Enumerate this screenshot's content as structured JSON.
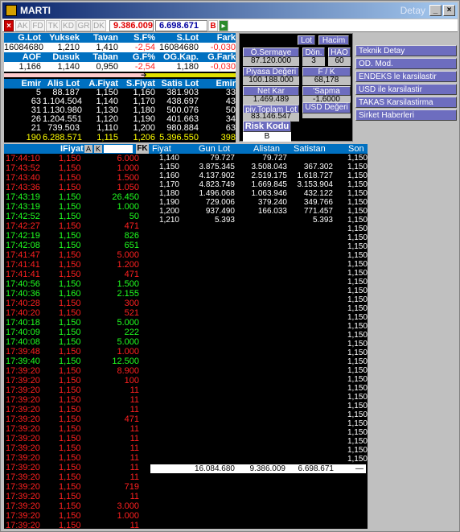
{
  "window": {
    "title": "MARTI",
    "detay": "Detay"
  },
  "toolbar": {
    "tabs": [
      "AK",
      "FD",
      "TK",
      "KD",
      "GR",
      "DK"
    ],
    "value1": "9.386.009",
    "value2": "6.698.671",
    "b_label": "B"
  },
  "summary": {
    "headers1": [
      "G.Lot",
      "Yuksek",
      "Tavan",
      "S.F%",
      "S.Lot",
      "Fark"
    ],
    "values1": [
      "16084680",
      "1,210",
      "1,410",
      "-2,54",
      "16084680",
      "-0,030"
    ],
    "headers2": [
      "AOF",
      "Dusuk",
      "Taban",
      "G.F%",
      "OG.Kap.",
      "G.Fark"
    ],
    "values2": [
      "1,166",
      "1,140",
      "0,950",
      "-2,54",
      "1,180",
      "-0,030"
    ],
    "book_headers": [
      "Emir",
      "Alis Lot",
      "A.Fiyat",
      "S.Fiyat",
      "Satis Lot",
      "Emir"
    ],
    "book_rows": [
      [
        "5",
        "88.187",
        "1,150",
        "1,160",
        "381.903",
        "33"
      ],
      [
        "63",
        "1.104.504",
        "1,140",
        "1,170",
        "438.697",
        "43"
      ],
      [
        "31",
        "1.130.980",
        "1,130",
        "1,180",
        "500.076",
        "50"
      ],
      [
        "26",
        "1.204.551",
        "1,120",
        "1,190",
        "401.663",
        "34"
      ],
      [
        "21",
        "739.503",
        "1,110",
        "1,200",
        "980.884",
        "63"
      ]
    ],
    "book_total": [
      "190",
      "6.288.571",
      "1,115",
      "1,206",
      "5.396.550",
      "398"
    ]
  },
  "panel": {
    "lot": "Lot",
    "hacim": "Hacim",
    "o_sermaye": "Ö.Sermaye",
    "o_sermaye_val": "87.120.000",
    "don": "Dön.",
    "don_val": "3",
    "hao": "HAO",
    "hao_val": "60",
    "piyasa": "Piyasa Değeri",
    "piyasa_val": "100.188.000",
    "fk": "F / K",
    "fk_val": "68,178",
    "netkar": "Net Kar",
    "netkar_val": "1.469.489",
    "sapma": "'Sapma",
    "sapma_val": "-1,6000",
    "toplam": "piy.Toplam Lot",
    "toplam_val": "83.146.547",
    "usd": "USD Değeri",
    "risk": "Risk Kodu",
    "risk_val": "B"
  },
  "links": [
    "Teknik Detay",
    "OD. Mod.",
    "ENDEKS le karsilastir",
    "USD ile karsilastir",
    "TAKAS Karsilastirma",
    "Sirket Haberleri"
  ],
  "trades": {
    "header": {
      "fiyat": "IFiyat",
      "a": "A",
      "k": "K",
      "fk": "FK"
    },
    "rows": [
      [
        "17:44:10",
        "1,150",
        "6.000",
        "r"
      ],
      [
        "17:43:52",
        "1,150",
        "1.000",
        "r"
      ],
      [
        "17:43:40",
        "1,150",
        "1.500",
        "r"
      ],
      [
        "17:43:36",
        "1,150",
        "1.050",
        "r"
      ],
      [
        "17:43:19",
        "1,150",
        "26.450",
        "g"
      ],
      [
        "17:43:19",
        "1,150",
        "1.000",
        "g"
      ],
      [
        "17:42:52",
        "1,150",
        "50",
        "g"
      ],
      [
        "17:42:27",
        "1,150",
        "471",
        "r"
      ],
      [
        "17:42:19",
        "1,150",
        "826",
        "g"
      ],
      [
        "17:42:08",
        "1,150",
        "651",
        "g"
      ],
      [
        "17:41:47",
        "1,150",
        "5.000",
        "r"
      ],
      [
        "17:41:41",
        "1,150",
        "1.200",
        "r"
      ],
      [
        "17:41:41",
        "1,150",
        "471",
        "r"
      ],
      [
        "17:40:56",
        "1,150",
        "1.500",
        "g"
      ],
      [
        "17:40:36",
        "1,160",
        "2.155",
        "g"
      ],
      [
        "17:40:28",
        "1,150",
        "300",
        "r"
      ],
      [
        "17:40:20",
        "1,150",
        "521",
        "r"
      ],
      [
        "17:40:18",
        "1,150",
        "5.000",
        "g"
      ],
      [
        "17:40:09",
        "1,150",
        "222",
        "g"
      ],
      [
        "17:40:08",
        "1,150",
        "5.000",
        "g"
      ],
      [
        "17:39:48",
        "1,150",
        "1.000",
        "r"
      ],
      [
        "17:39:40",
        "1,150",
        "12.500",
        "g"
      ],
      [
        "17:39:20",
        "1,150",
        "8.900",
        "r"
      ],
      [
        "17:39:20",
        "1,150",
        "100",
        "r"
      ],
      [
        "17:39:20",
        "1,150",
        "11",
        "r"
      ],
      [
        "17:39:20",
        "1,150",
        "11",
        "r"
      ],
      [
        "17:39:20",
        "1,150",
        "11",
        "r"
      ],
      [
        "17:39:20",
        "1,150",
        "471",
        "r"
      ],
      [
        "17:39:20",
        "1,150",
        "11",
        "r"
      ],
      [
        "17:39:20",
        "1,150",
        "11",
        "r"
      ],
      [
        "17:39:20",
        "1,150",
        "11",
        "r"
      ],
      [
        "17:39:20",
        "1,150",
        "11",
        "r"
      ],
      [
        "17:39:20",
        "1,150",
        "11",
        "r"
      ],
      [
        "17:39:20",
        "1,150",
        "11",
        "r"
      ],
      [
        "17:39:20",
        "1,150",
        "719",
        "r"
      ],
      [
        "17:39:20",
        "1,150",
        "11",
        "r"
      ],
      [
        "17:39:20",
        "1,150",
        "3.000",
        "r"
      ],
      [
        "17:39:20",
        "1,150",
        "1.000",
        "r"
      ],
      [
        "17:39:20",
        "1,150",
        "11",
        "r"
      ]
    ]
  },
  "depth": {
    "headers": [
      "Fiyat",
      "Gun Lot",
      "Alistan",
      "Satistan",
      "Son"
    ],
    "rows": [
      [
        "1,140",
        "79.727",
        "79.727",
        ""
      ],
      [
        "1,150",
        "3.875.345",
        "3.508.043",
        "367.302"
      ],
      [
        "1,160",
        "4.137.902",
        "2.519.175",
        "1.618.727"
      ],
      [
        "1,170",
        "4.823.749",
        "1.669.845",
        "3.153.904"
      ],
      [
        "1,180",
        "1.496.068",
        "1.063.946",
        "432.122"
      ],
      [
        "1,190",
        "729.006",
        "379.240",
        "349.766"
      ],
      [
        "1,200",
        "937.490",
        "166.033",
        "771.457"
      ],
      [
        "1,210",
        "5.393",
        "",
        "5.393"
      ]
    ],
    "son": "1,150",
    "totals": [
      "16.084.680",
      "9.386.009",
      "6.698.671",
      "—"
    ]
  },
  "colors": {
    "red": "#ff2020",
    "green": "#20ff20",
    "yellow": "#ffff00",
    "header_blue": "#0070c0",
    "button_purple": "#6d6dbf"
  }
}
